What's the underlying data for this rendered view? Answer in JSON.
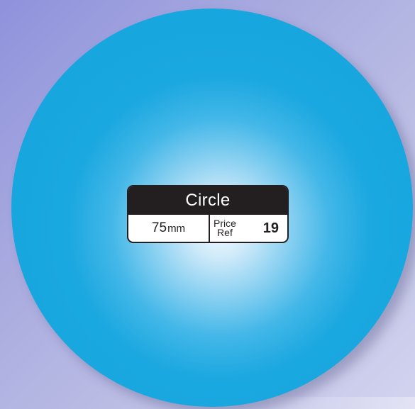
{
  "product": {
    "shape": "Circle",
    "size_value": "75",
    "size_unit": "mm",
    "price_ref_label_line1": "Price",
    "price_ref_label_line2": "Ref",
    "price_ref_value": "19"
  },
  "colors": {
    "disc": "#12a3dc",
    "disc_center": "#f6fbff",
    "label_dark": "#231f20",
    "background": "#a9abdf"
  }
}
